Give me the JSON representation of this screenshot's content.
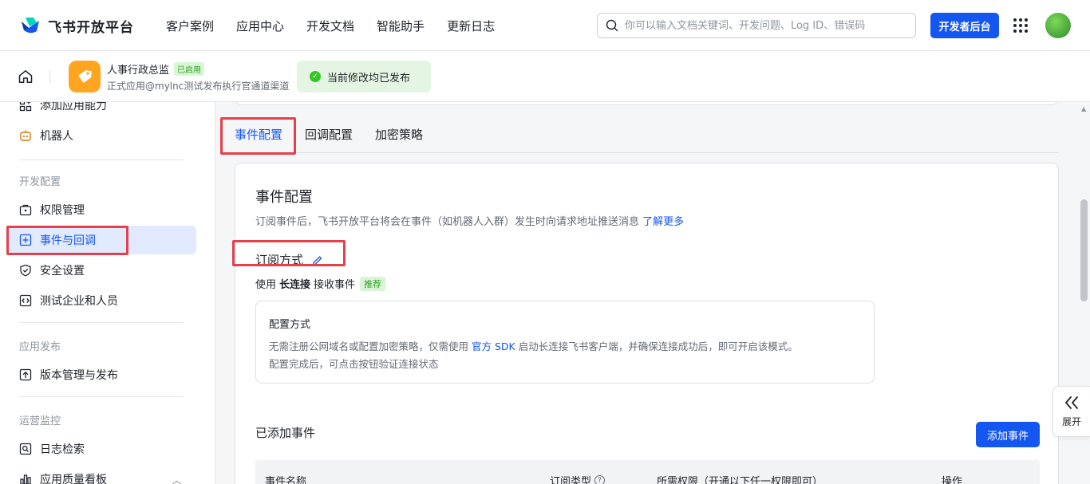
{
  "topnav": {
    "logo_text": "飞书开放平台",
    "links": [
      "客户案例",
      "应用中心",
      "开发文档",
      "智能助手",
      "更新日志"
    ],
    "search_placeholder": "你可以输入文档关键词、开发问题、Log ID、错误码",
    "dev_console_label": "开发者后台"
  },
  "appbar": {
    "app_name": "人事行政总监",
    "status_badge": "已启用",
    "app_subtitle": "正式应用@mylnc测试发布执行官通道渠道",
    "publish_status": "当前修改均已发布"
  },
  "sidebar": {
    "items_top": [
      {
        "label": "添加应用能力",
        "icon": "grid-plus-icon"
      },
      {
        "label": "机器人",
        "icon": "robot-icon"
      }
    ],
    "group_dev": "开发配置",
    "items_dev": [
      {
        "label": "权限管理",
        "icon": "lock-box-icon"
      },
      {
        "label": "事件与回调",
        "icon": "event-icon"
      },
      {
        "label": "安全设置",
        "icon": "shield-icon"
      },
      {
        "label": "测试企业和人员",
        "icon": "code-box-icon"
      }
    ],
    "group_release": "应用发布",
    "items_release": [
      {
        "label": "版本管理与发布",
        "icon": "upload-box-icon"
      }
    ],
    "group_ops": "运营监控",
    "items_ops": [
      {
        "label": "日志检索",
        "icon": "log-search-icon"
      },
      {
        "label": "应用质量看板",
        "icon": "bar-chart-icon"
      }
    ]
  },
  "main": {
    "tabs": [
      "事件配置",
      "回调配置",
      "加密策略"
    ],
    "active_tab": "事件配置",
    "card": {
      "title": "事件配置",
      "desc": "订阅事件后，飞书开放平台将会在事件（如机器人入群）发生时向请求地址推送消息",
      "desc_link": "了解更多",
      "sub_title": "订阅方式",
      "mode_prefix": "使用",
      "mode_bold": "长连接",
      "mode_suffix": "接收事件",
      "mode_badge": "推荐",
      "info_title": "配置方式",
      "info_line1_a": "无需注册公网域名或配置加密策略，仅需使用",
      "info_line1_link": "官方 SDK",
      "info_line1_b": "启动长连接飞书客户端，并确保连接成功后，即可开启该模式。",
      "info_line2": "配置完成后，可点击按钮验证连接状态",
      "added_title": "已添加事件",
      "add_button": "添加事件",
      "table_headers": [
        "事件名称",
        "订阅类型",
        "所需权限（开通以下任一权限即可）",
        "操作"
      ]
    }
  },
  "expand_label": "展开",
  "colors": {
    "accent": "#1456f0",
    "highlight": "#e6404a",
    "success": "#34c724"
  }
}
